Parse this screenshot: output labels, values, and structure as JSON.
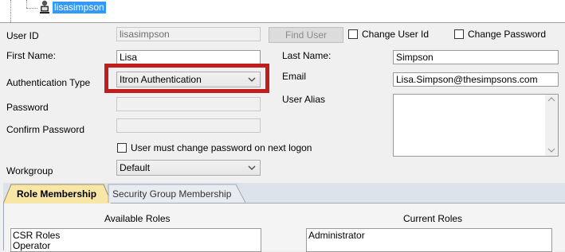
{
  "tree": {
    "selected_user": "lisasimpson"
  },
  "form": {
    "user_id_label": "User ID",
    "user_id_value": "lisasimpson",
    "find_user_label": "Find User",
    "change_user_id_label": "Change User Id",
    "change_password_label": "Change Password",
    "first_name_label": "First Name:",
    "first_name_value": "Lisa",
    "last_name_label": "Last Name:",
    "last_name_value": "Simpson",
    "auth_type_label": "Authentication Type",
    "auth_type_value": "Itron Authentication",
    "email_label": "Email",
    "email_value": "Lisa.Simpson@thesimpsons.com",
    "password_label": "Password",
    "confirm_password_label": "Confirm Password",
    "user_alias_label": "User Alias",
    "must_change_password_label": "User must change password on next logon",
    "workgroup_label": "Workgroup",
    "workgroup_value": "Default"
  },
  "tabs": [
    {
      "label": "Role Membership",
      "active": true
    },
    {
      "label": "Security Group Membership",
      "active": false
    }
  ],
  "roles": {
    "available_title": "Available Roles",
    "available": [
      "CSR Roles",
      "Operator"
    ],
    "current_title": "Current Roles",
    "current": [
      "Administrator"
    ]
  },
  "colors": {
    "highlight_box": "#c01e1e",
    "tab_active": "#f7e6a6",
    "selection": "#3399ff"
  }
}
